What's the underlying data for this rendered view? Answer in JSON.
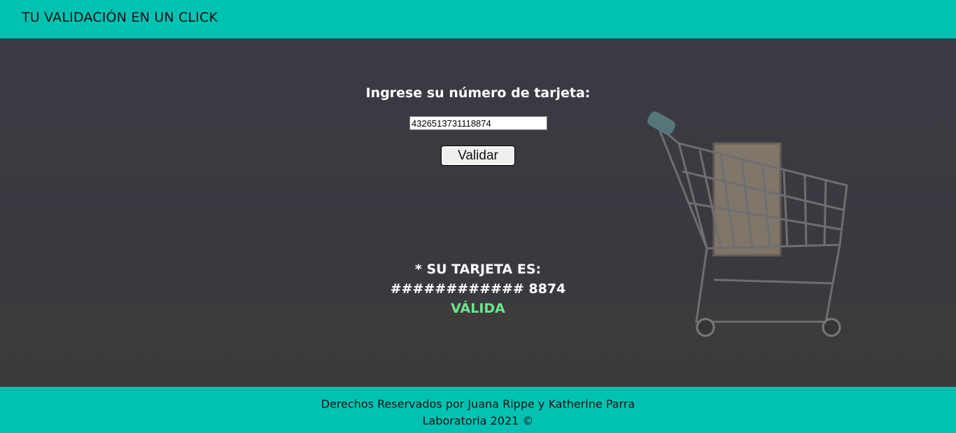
{
  "header": {
    "title": "TU VALIDACIÓN EN UN CLICK"
  },
  "form": {
    "prompt": "Ingrese su número de tarjeta:",
    "card_value": "4326513731118874",
    "validate_label": "Validar"
  },
  "result": {
    "heading": "* SU TARJETA ES:",
    "masked_number": "############ 8874",
    "status": "VÁLIDA",
    "status_color": "#6be78c"
  },
  "footer": {
    "line1": "Derechos Reservados por Juana Rippe y Katherine Parra",
    "line2": "Laboratoria 2021 ©"
  },
  "colors": {
    "brand_teal": "#00c2b3",
    "background_dark": "#3b3a42"
  }
}
